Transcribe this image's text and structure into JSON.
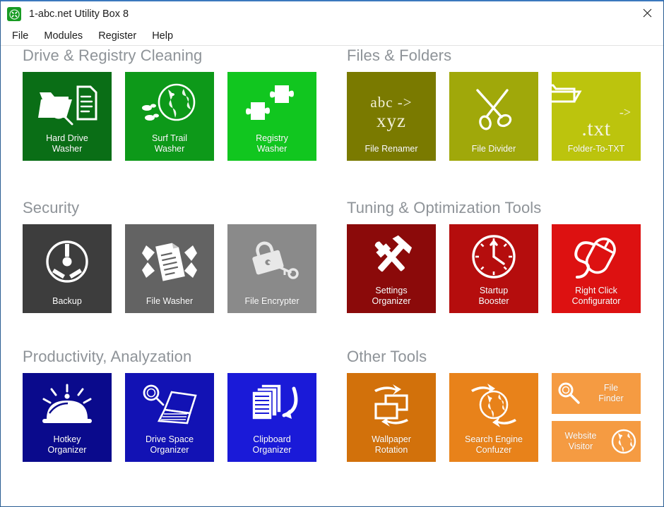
{
  "window": {
    "title": "1-abc.net Utility Box 8",
    "app_icon": "tools-icon",
    "close_label": "close-icon"
  },
  "menu": {
    "items": [
      {
        "label": "File"
      },
      {
        "label": "Modules"
      },
      {
        "label": "Register"
      },
      {
        "label": "Help"
      }
    ]
  },
  "colors": {
    "section_title": "#8e9398",
    "green_dark": "#0a6e16",
    "green_mid": "#0d9919",
    "green_bright": "#11c61f",
    "olive_dark": "#7a7a00",
    "olive_mid": "#a0a80a",
    "olive_bright": "#bcc40d",
    "gray_dark": "#3d3d3d",
    "gray_mid": "#636363",
    "gray_light": "#8a8a8a",
    "red_dark": "#8b0a0a",
    "red_mid": "#b50d0d",
    "red_bright": "#dd1111",
    "blue_dark": "#0a0a8c",
    "blue_mid": "#1212b4",
    "blue_bright": "#1a1ad8",
    "orange_dark": "#d2710b",
    "orange_mid": "#e8821a",
    "orange_light": "#f59b42"
  },
  "sections": {
    "drive_registry": {
      "title": "Drive & Registry Cleaning",
      "tiles": [
        {
          "label": "Hard Drive\nWasher",
          "icon": "folder-magnifier-document-icon",
          "color": "#0a6e16"
        },
        {
          "label": "Surf Trail\nWasher",
          "icon": "globe-footprints-icon",
          "color": "#0d9919"
        },
        {
          "label": "Registry\nWasher",
          "icon": "puzzle-pieces-icon",
          "color": "#11c61f"
        }
      ]
    },
    "files_folders": {
      "title": "Files & Folders",
      "tiles": [
        {
          "label": "File Renamer",
          "icon": "abc-to-xyz-text-icon",
          "color": "#7a7a00",
          "line1": "abc  ->",
          "line2": "xyz"
        },
        {
          "label": "File Divider",
          "icon": "scissors-icon",
          "color": "#a0a80a"
        },
        {
          "label": "Folder-To-TXT",
          "icon": "folder-to-txt-icon",
          "color": "#bcc40d",
          "line1": "->",
          "line2": ".txt"
        }
      ]
    },
    "security": {
      "title": "Security",
      "tiles": [
        {
          "label": "Backup",
          "icon": "backup-wheel-icon",
          "color": "#3d3d3d"
        },
        {
          "label": "File Washer",
          "icon": "shredded-document-icon",
          "color": "#636363"
        },
        {
          "label": "File Encrypter",
          "icon": "padlock-key-icon",
          "color": "#8a8a8a"
        }
      ]
    },
    "tuning": {
      "title": "Tuning & Optimization Tools",
      "tiles": [
        {
          "label": "Settings\nOrganizer",
          "icon": "hammer-wrench-icon",
          "color": "#8b0a0a"
        },
        {
          "label": "Startup\nBooster",
          "icon": "clock-arrow-icon",
          "color": "#b50d0d"
        },
        {
          "label": "Right Click\nConfigurator",
          "icon": "computer-mouse-icon",
          "color": "#dd1111"
        }
      ]
    },
    "productivity": {
      "title": "Productivity, Analyzation",
      "tiles": [
        {
          "label": "Hotkey\nOrganizer",
          "icon": "service-bell-icon",
          "color": "#0a0a8c"
        },
        {
          "label": "Drive Space\nOrganizer",
          "icon": "laptop-magnifier-icon",
          "color": "#1212b4"
        },
        {
          "label": "Clipboard\nOrganizer",
          "icon": "documents-arrow-icon",
          "color": "#1a1ad8"
        }
      ]
    },
    "other_tools": {
      "title": "Other Tools",
      "tiles": [
        {
          "label": "Wallpaper\nRotation",
          "icon": "screens-rotate-icon",
          "color": "#d2710b"
        },
        {
          "label": "Search Engine\nConfuzer",
          "icon": "globe-arrows-icon",
          "color": "#e8821a"
        }
      ],
      "half_tiles": [
        {
          "label": "File\nFinder",
          "icon": "magnifier-icon",
          "color": "#f59b42",
          "icon_side": "left"
        },
        {
          "label": "Website\nVisitor",
          "icon": "globe-circle-icon",
          "color": "#f59b42",
          "icon_side": "right"
        }
      ]
    }
  }
}
